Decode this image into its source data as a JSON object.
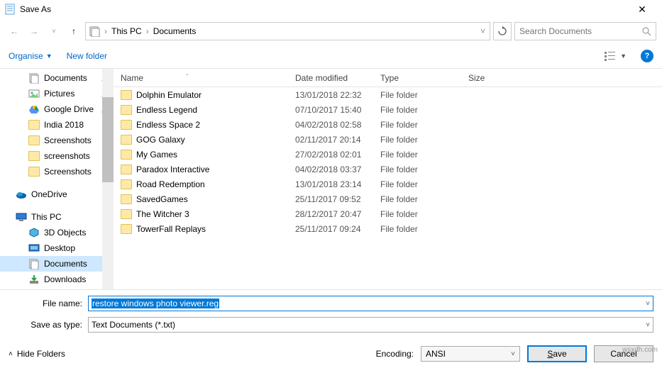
{
  "window": {
    "title": "Save As"
  },
  "breadcrumb": {
    "root": "This PC",
    "folder": "Documents"
  },
  "search": {
    "placeholder": "Search Documents"
  },
  "toolbar": {
    "organise": "Organise",
    "new_folder": "New folder"
  },
  "columns": {
    "name": "Name",
    "date": "Date modified",
    "type": "Type",
    "size": "Size"
  },
  "sidebar": [
    {
      "label": "Documents",
      "icon": "doc",
      "pin": true,
      "lvl": 2
    },
    {
      "label": "Pictures",
      "icon": "pic",
      "pin": true,
      "lvl": 2
    },
    {
      "label": "Google Drive",
      "icon": "gdrive",
      "pin": true,
      "lvl": 2
    },
    {
      "label": "India 2018",
      "icon": "folder",
      "pin": false,
      "lvl": 2
    },
    {
      "label": "Screenshots",
      "icon": "folder",
      "pin": false,
      "lvl": 2
    },
    {
      "label": "screenshots",
      "icon": "folder",
      "pin": false,
      "lvl": 2
    },
    {
      "label": "Screenshots",
      "icon": "folder",
      "pin": false,
      "lvl": 2
    },
    {
      "label": "",
      "icon": "",
      "pin": false,
      "lvl": 0,
      "spacer": true
    },
    {
      "label": "OneDrive",
      "icon": "onedrive",
      "pin": false,
      "lvl": 1
    },
    {
      "label": "",
      "icon": "",
      "pin": false,
      "lvl": 0,
      "spacer": true
    },
    {
      "label": "This PC",
      "icon": "thispc",
      "pin": false,
      "lvl": 1
    },
    {
      "label": "3D Objects",
      "icon": "3d",
      "pin": false,
      "lvl": 2
    },
    {
      "label": "Desktop",
      "icon": "desk",
      "pin": false,
      "lvl": 2
    },
    {
      "label": "Documents",
      "icon": "doc",
      "pin": false,
      "lvl": 2,
      "selected": true
    },
    {
      "label": "Downloads",
      "icon": "dl",
      "pin": false,
      "lvl": 2
    }
  ],
  "files": [
    {
      "name": "Dolphin Emulator",
      "date": "13/01/2018 22:32",
      "type": "File folder"
    },
    {
      "name": "Endless Legend",
      "date": "07/10/2017 15:40",
      "type": "File folder"
    },
    {
      "name": "Endless Space 2",
      "date": "04/02/2018 02:58",
      "type": "File folder"
    },
    {
      "name": "GOG Galaxy",
      "date": "02/11/2017 20:14",
      "type": "File folder"
    },
    {
      "name": "My Games",
      "date": "27/02/2018 02:01",
      "type": "File folder"
    },
    {
      "name": "Paradox Interactive",
      "date": "04/02/2018 03:37",
      "type": "File folder"
    },
    {
      "name": "Road Redemption",
      "date": "13/01/2018 23:14",
      "type": "File folder"
    },
    {
      "name": "SavedGames",
      "date": "25/11/2017 09:52",
      "type": "File folder"
    },
    {
      "name": "The Witcher 3",
      "date": "28/12/2017 20:47",
      "type": "File folder"
    },
    {
      "name": "TowerFall Replays",
      "date": "25/11/2017 09:24",
      "type": "File folder"
    }
  ],
  "form": {
    "filename_label": "File name:",
    "filename_value": "restore windows photo viewer.reg",
    "type_label": "Save as type:",
    "type_value": "Text Documents (*.txt)"
  },
  "footer": {
    "hide_folders": "Hide Folders",
    "encoding_label": "Encoding:",
    "encoding_value": "ANSI",
    "save": "Save",
    "cancel": "Cancel"
  },
  "watermark": "wsxdh.com"
}
